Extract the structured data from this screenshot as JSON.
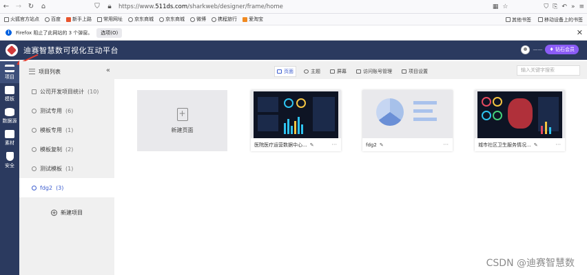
{
  "browser": {
    "url_prefix": "https://www.",
    "url_domain": "511ds.com",
    "url_path": "/sharkweb/designer/frame/home",
    "bookmarks": [
      "火狐官方站点",
      "百度",
      "新手上路",
      "常用网址",
      "京东商城",
      "京东商城",
      "微博",
      "携程旅行",
      "爱淘宝"
    ],
    "bookmarks_right": [
      "其他书签",
      "移动设备上的书签"
    ],
    "notice_text": "Firefox 阻止了此网站的 3 个弹窗。",
    "notice_button": "选项(O)"
  },
  "app": {
    "title": "迪赛智慧数可视化互动平台",
    "user_name": "——",
    "vip_label": "钻石会员"
  },
  "rail": [
    {
      "label": "项目",
      "icon": "layers-icon"
    },
    {
      "label": "模板",
      "icon": "template-icon"
    },
    {
      "label": "数据源",
      "icon": "database-icon"
    },
    {
      "label": "素材",
      "icon": "image-icon"
    },
    {
      "label": "安全",
      "icon": "shield-icon"
    }
  ],
  "panel": {
    "title": "项目列表",
    "collapse": "«",
    "projects": [
      {
        "name": "公司开发项目统计",
        "count": "(10)"
      },
      {
        "name": "测试专用",
        "count": "(6)"
      },
      {
        "name": "模板专用",
        "count": "(1)"
      },
      {
        "name": "模板复制",
        "count": "(2)"
      },
      {
        "name": "测试模板",
        "count": "(1)"
      },
      {
        "name": "fdg2",
        "count": "(3)"
      }
    ],
    "new_project": "新建项目"
  },
  "main": {
    "tabs": [
      "页面",
      "主题",
      "屏幕",
      "访问账号管理",
      "项目设置"
    ],
    "search_placeholder": "输入关键字搜索",
    "new_page": "新建页面",
    "cards": [
      {
        "title": "医院医疗运营数据中心...",
        "edit": "✎",
        "more": "···"
      },
      {
        "title": "fdg2",
        "edit": "✎",
        "more": "···"
      },
      {
        "title": "城市社区卫生服务情况...",
        "edit": "✎",
        "more": "···"
      }
    ]
  },
  "watermark": "CSDN @迪赛智慧数",
  "colors": {
    "header": "#2b3a5f",
    "accent": "#3b5ccf",
    "vip": "#8b5cf6"
  }
}
